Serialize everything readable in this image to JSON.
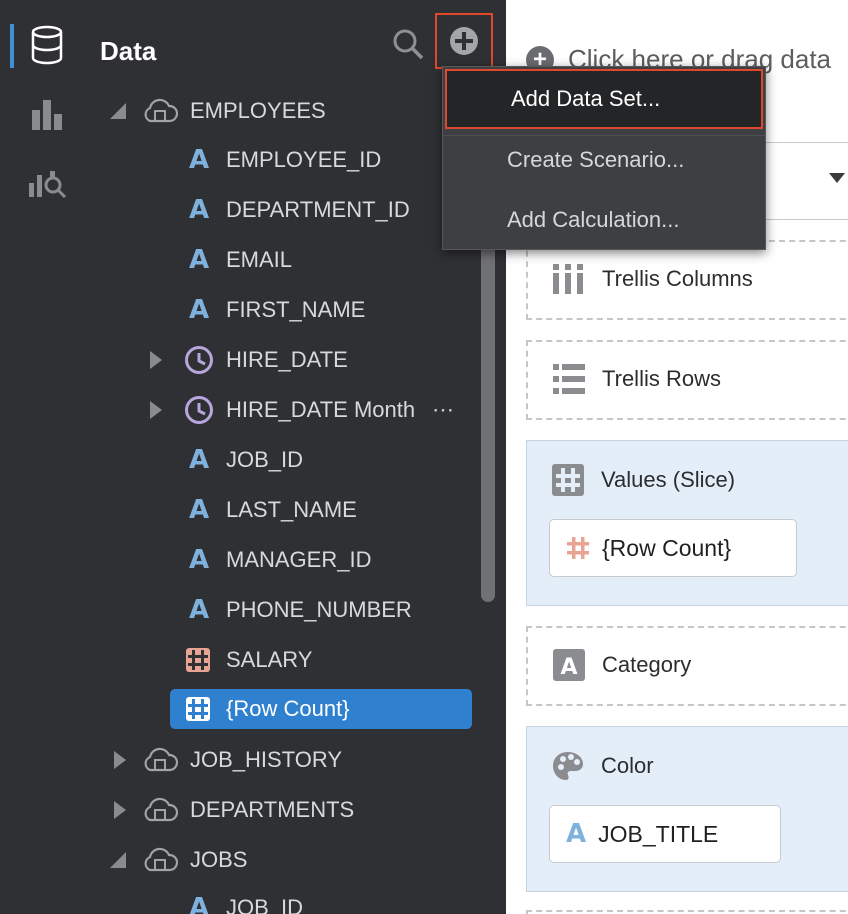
{
  "panel": {
    "title": "Data"
  },
  "tree": [
    {
      "label": "EMPLOYEES",
      "type": "dataset",
      "expanded": true
    },
    {
      "label": "EMPLOYEE_ID",
      "type": "attribute"
    },
    {
      "label": "DEPARTMENT_ID",
      "type": "attribute"
    },
    {
      "label": "EMAIL",
      "type": "attribute"
    },
    {
      "label": "FIRST_NAME",
      "type": "attribute"
    },
    {
      "label": "HIRE_DATE",
      "type": "time",
      "expandable": true
    },
    {
      "label": "HIRE_DATE Month",
      "type": "time",
      "expandable": true,
      "more": "⋯"
    },
    {
      "label": "JOB_ID",
      "type": "attribute"
    },
    {
      "label": "LAST_NAME",
      "type": "attribute"
    },
    {
      "label": "MANAGER_ID",
      "type": "attribute"
    },
    {
      "label": "PHONE_NUMBER",
      "type": "attribute"
    },
    {
      "label": "SALARY",
      "type": "measure"
    },
    {
      "label": "{Row Count}",
      "type": "measure",
      "selected": true
    },
    {
      "label": "JOB_HISTORY",
      "type": "dataset",
      "expanded": false
    },
    {
      "label": "DEPARTMENTS",
      "type": "dataset",
      "expanded": false
    },
    {
      "label": "JOBS",
      "type": "dataset",
      "expanded": true
    },
    {
      "label": "JOB_ID",
      "type": "attribute"
    }
  ],
  "menu": {
    "items": [
      "Add Data Set...",
      "Create Scenario...",
      "Add Calculation..."
    ]
  },
  "grammar": {
    "drop_hint": "Click here or drag data",
    "slots": {
      "trellis_columns": "Trellis Columns",
      "trellis_rows": "Trellis Rows",
      "values": "Values (Slice)",
      "values_pill": "{Row Count}",
      "category": "Category",
      "color": "Color",
      "color_pill": "JOB_TITLE"
    }
  },
  "colors": {
    "accent_blue": "#3080d0",
    "highlight_red": "#e0482b",
    "attribute_icon": "#7fb1dd",
    "measure_icon": "#e8a393",
    "time_icon": "#b9a6de"
  },
  "icons": {
    "rail": [
      "database-icon",
      "visualizations-icon",
      "analytics-icon"
    ],
    "panel": [
      "search-icon",
      "add-icon"
    ]
  }
}
